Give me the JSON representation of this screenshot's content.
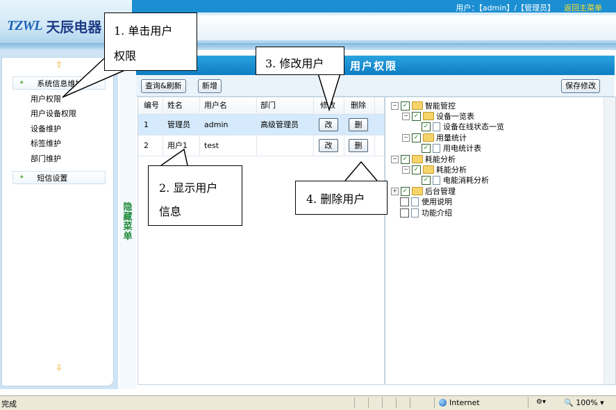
{
  "header": {
    "logo_mark": "TZWL",
    "logo_text": "天辰电器",
    "user_info": "用户：【admin】/【管理员】",
    "back_link": "返回主菜单"
  },
  "left_menu": {
    "groups": [
      {
        "label": "系统信息维护",
        "items": [
          "用户权限",
          "用户设备权限",
          "设备维护",
          "标签维护",
          "部门维护"
        ]
      },
      {
        "label": "短信设置",
        "items": []
      }
    ]
  },
  "hide_menu": "隐藏菜单",
  "page_title": "用户权限",
  "toolbar": {
    "query": "查询&刷新",
    "add": "新增",
    "save": "保存修改"
  },
  "table": {
    "columns": [
      "编号",
      "姓名",
      "用户名",
      "部门",
      "修改",
      "删除"
    ],
    "rows": [
      {
        "id": "1",
        "name": "管理员",
        "username": "admin",
        "dept": "高级管理员",
        "edit": "改",
        "del": "删"
      },
      {
        "id": "2",
        "name": "用户1",
        "username": "test",
        "dept": "",
        "edit": "改",
        "del": "删"
      }
    ]
  },
  "tree": [
    {
      "label": "智能管控",
      "checked": true
    },
    {
      "label": "设备一览表",
      "checked": true
    },
    {
      "label": "设备在线状态一览",
      "checked": true
    },
    {
      "label": "用量统计",
      "checked": true
    },
    {
      "label": "用电统计表",
      "checked": true
    },
    {
      "label": "耗能分析",
      "checked": true
    },
    {
      "label": "耗能分析",
      "checked": true
    },
    {
      "label": "电能消耗分析",
      "checked": true
    },
    {
      "label": "后台管理",
      "checked": true
    },
    {
      "label": "使用说明",
      "checked": false
    },
    {
      "label": "功能介绍",
      "checked": false
    }
  ],
  "callouts": [
    {
      "line1": "1. 单击用户",
      "line2": "权限"
    },
    {
      "line1": "2. 显示用户",
      "line2": "信息"
    },
    {
      "line1": "3. 修改用户",
      "line2": ""
    },
    {
      "line1": "4. 删除用户",
      "line2": ""
    }
  ],
  "statusbar": {
    "status": "完成",
    "zone": "Internet",
    "zoom": "100%"
  }
}
